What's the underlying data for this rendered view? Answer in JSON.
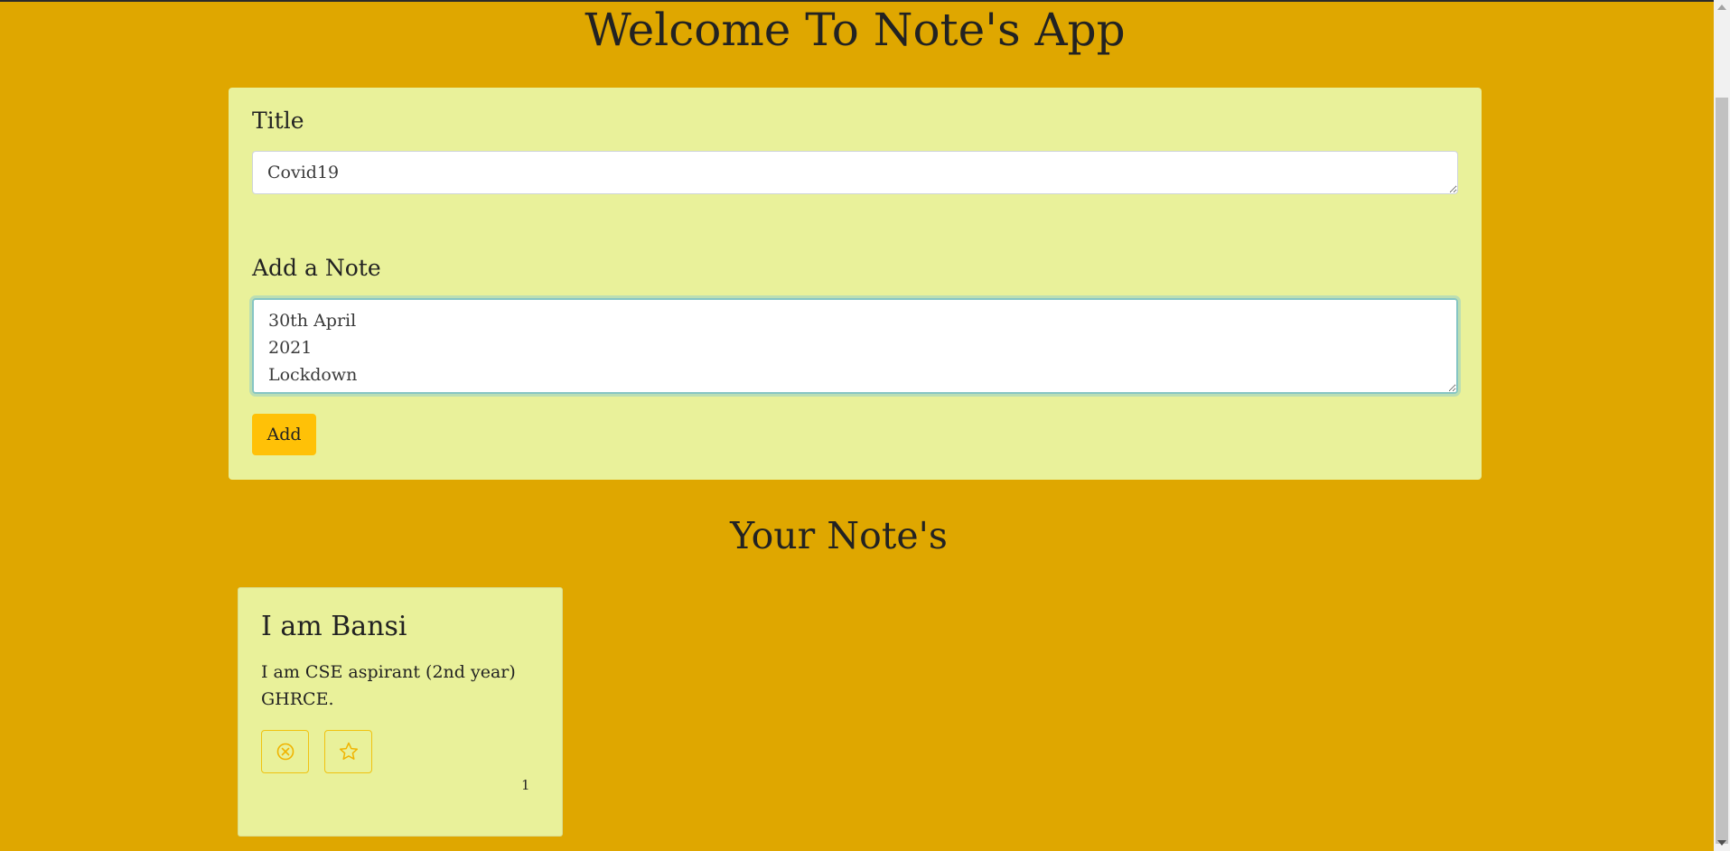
{
  "app": {
    "title": "Welcome To Note's App"
  },
  "form": {
    "title_label": "Title",
    "title_value": "Covid19",
    "note_label": "Add a Note",
    "note_value": "30th April\n2021\nLockdown",
    "add_label": "Add"
  },
  "notes_section": {
    "heading": "Your Note's",
    "notes": [
      {
        "title": "I am Bansi",
        "text": "I am CSE aspirant (2nd year) GHRCE.",
        "number": "1",
        "delete_icon": "circle-x-icon",
        "favorite_icon": "star-icon"
      }
    ]
  },
  "colors": {
    "page_background": "#dfa700",
    "card_background": "#e9f19a",
    "accent": "#ffc107"
  }
}
